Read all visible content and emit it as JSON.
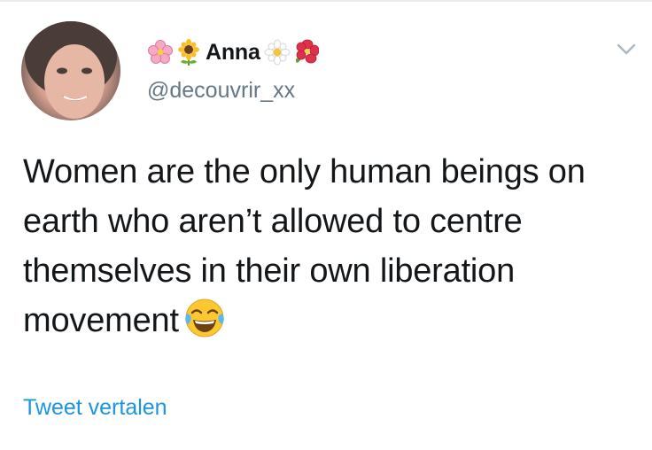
{
  "tweet": {
    "author": {
      "display_name": "Anna",
      "handle": "@decouvrir_xx",
      "name_decorations": [
        "cherry-blossom-icon",
        "sunflower-icon",
        "blossom-icon",
        "hibiscus-icon"
      ]
    },
    "text": "Women are the only human beings on earth who aren’t allowed to centre themselves in their own liberation movement",
    "trailing_emoji": "face-with-tears-of-joy-icon",
    "translate_label": "Tweet vertalen"
  },
  "colors": {
    "text": "#14171a",
    "secondary": "#657786",
    "link": "#1b95e0",
    "chevron": "#aab8c2"
  }
}
